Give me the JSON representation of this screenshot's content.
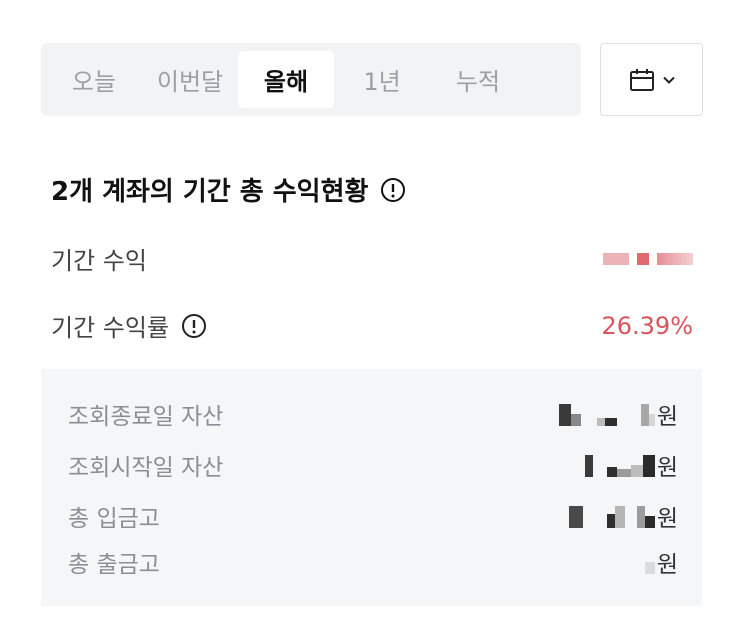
{
  "tabs": [
    {
      "label": "오늘",
      "active": false
    },
    {
      "label": "이번달",
      "active": false
    },
    {
      "label": "올해",
      "active": true
    },
    {
      "label": "1년",
      "active": false
    },
    {
      "label": "누적",
      "active": false
    }
  ],
  "calendar_button": {
    "icon": "calendar-icon",
    "chevron": "chevron-down-icon"
  },
  "summary": {
    "title": "2개 계좌의 기간 총 수익현황",
    "period_profit_label": "기간 수익",
    "period_return_label": "기간 수익률",
    "period_return_value": "26.39%"
  },
  "details": [
    {
      "label": "조회종료일 자산",
      "unit": "원"
    },
    {
      "label": "조회시작일 자산",
      "unit": "원"
    },
    {
      "label": "총 입금고",
      "unit": "원"
    },
    {
      "label": "총 출금고",
      "unit": "원"
    }
  ],
  "colors": {
    "accent_red": "#d9545c",
    "tab_bg": "#f2f3f5",
    "detail_bg": "#f5f6f8"
  }
}
